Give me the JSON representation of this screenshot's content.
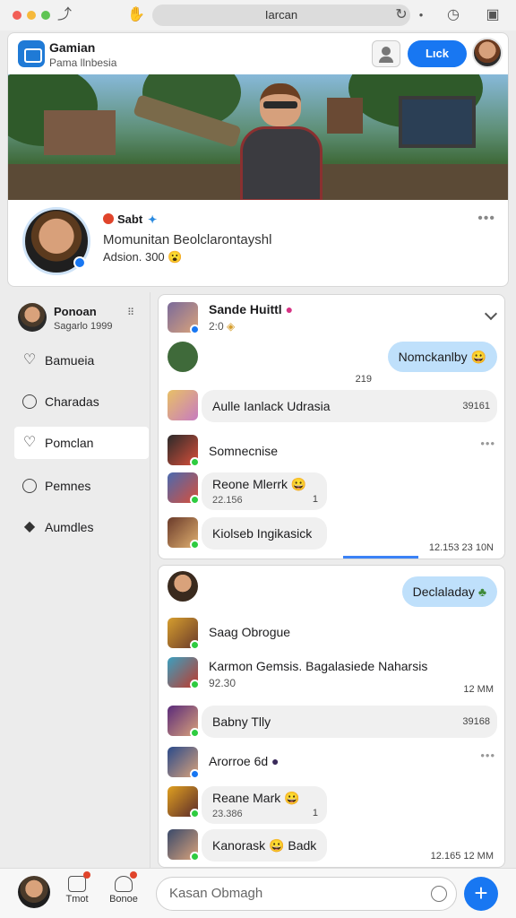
{
  "browser": {
    "url": "Iаrcan"
  },
  "app": {
    "title": "Gamian",
    "subtitle": "Pama llnbesia",
    "action_button": "Lıck"
  },
  "profile": {
    "name": "Sabt",
    "description": "Momunitan Beolclarontayshl",
    "meta": "Adsion. 300 😮"
  },
  "sidebar": {
    "user_name": "Ponoan",
    "user_sub": "Sagarlo 1999",
    "more": "⠿",
    "items": [
      {
        "label": "Bamueia",
        "icon": "heart-icon"
      },
      {
        "label": "Charadas",
        "icon": "clock-icon"
      },
      {
        "label": "Pomclan",
        "icon": "heart-icon"
      },
      {
        "label": "Pemnes",
        "icon": "clock-icon"
      },
      {
        "label": "Aumdles",
        "icon": "diamond-icon"
      }
    ]
  },
  "panel1": {
    "header_name": "Sande Huittl",
    "header_sub": "2:0",
    "outgoing": "Nomckanlby 😀",
    "outgoing_time": "219",
    "rows": [
      {
        "text": "Aulle Ianlack Udrasia",
        "meta": "39161"
      },
      {
        "text": "Somnecnise",
        "meta": ""
      },
      {
        "text": "Reone Mlerrk 😀",
        "sub": "22.156",
        "meta": "1"
      },
      {
        "text": "Kiolseb Ingikasick",
        "meta": "12.153  23 10N"
      }
    ]
  },
  "panel2": {
    "outgoing": "Declaladay",
    "rows": [
      {
        "text": "Saag Obrogue",
        "meta": ""
      },
      {
        "text": "Karmon Gemsis. Bagalasiede Naharsis",
        "sub": "92.30",
        "meta": "12 MM"
      },
      {
        "text": "Babny Tlly",
        "meta": "39168"
      },
      {
        "text": "Arorroe 6d",
        "meta": ""
      },
      {
        "text": "Reane Mark 😀",
        "sub": "23.386",
        "meta": "1"
      },
      {
        "text": "Kanorask 😀 Badk",
        "meta": "12.165  12 MM"
      }
    ]
  },
  "bottom": {
    "tab1": "Tmot",
    "tab2": "Bonoe",
    "compose_placeholder": "Kasan Obmagh",
    "fab": "+"
  },
  "colors": {
    "accent": "#1877f2",
    "outgoing_bubble": "#bfe0fb"
  }
}
